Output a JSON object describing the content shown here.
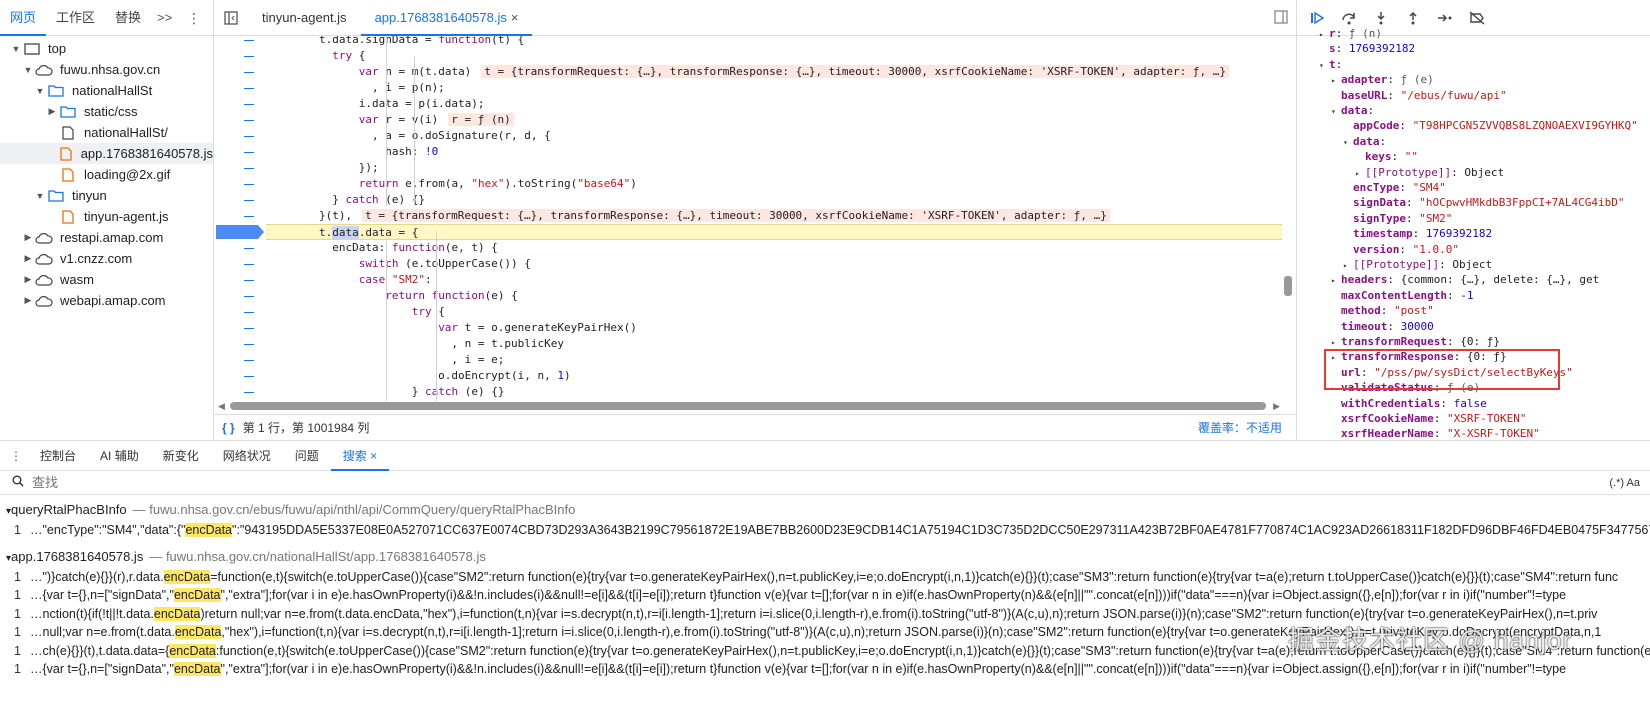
{
  "navigator": {
    "tabs": [
      "网页",
      "工作区",
      "替换"
    ],
    "more": ">>",
    "tree": [
      {
        "label": "top",
        "level": 0,
        "type": "frame",
        "expanded": true
      },
      {
        "label": "fuwu.nhsa.gov.cn",
        "level": 1,
        "type": "cloud",
        "expanded": true
      },
      {
        "label": "nationalHallSt",
        "level": 2,
        "type": "folder",
        "expanded": true
      },
      {
        "label": "static/css",
        "level": 3,
        "type": "folder",
        "expanded": false
      },
      {
        "label": "nationalHallSt/",
        "level": 3,
        "type": "file",
        "expanded": null
      },
      {
        "label": "app.1768381640578.js",
        "level": 3,
        "type": "js",
        "expanded": null,
        "selected": true
      },
      {
        "label": "loading@2x.gif",
        "level": 3,
        "type": "js",
        "expanded": null
      },
      {
        "label": "tinyun",
        "level": 2,
        "type": "folder",
        "expanded": true
      },
      {
        "label": "tinyun-agent.js",
        "level": 3,
        "type": "js",
        "expanded": null
      },
      {
        "label": "restapi.amap.com",
        "level": 1,
        "type": "cloud",
        "expanded": false
      },
      {
        "label": "v1.cnzz.com",
        "level": 1,
        "type": "cloud",
        "expanded": false
      },
      {
        "label": "wasm",
        "level": 1,
        "type": "cloud",
        "expanded": false
      },
      {
        "label": "webapi.amap.com",
        "level": 1,
        "type": "cloud",
        "expanded": false
      }
    ]
  },
  "editor": {
    "tabs": [
      {
        "label": "tinyun-agent.js",
        "active": false,
        "closable": false
      },
      {
        "label": "app.1768381640578.js",
        "active": true,
        "closable": true
      }
    ],
    "close_glyph": "×",
    "lines": [
      {
        "text": "        t.data.signData = function(t) {",
        "indent": 0,
        "inline": ""
      },
      {
        "text": "          try {",
        "inline": ""
      },
      {
        "text": "              var n = m(t.data)",
        "inline": "t = {transformRequest: {…}, transformResponse: {…}, timeout: 30000, xsrfCookieName: 'XSRF-TOKEN', adapter: ƒ, …}"
      },
      {
        "text": "                , i = p(n);",
        "inline": ""
      },
      {
        "text": "              i.data = p(i.data);",
        "inline": ""
      },
      {
        "text": "              var r = v(i)",
        "inline": "r = ƒ (n)"
      },
      {
        "text": "                , a = o.doSignature(r, d, {",
        "inline": ""
      },
      {
        "text": "                  hash: !0",
        "inline": ""
      },
      {
        "text": "              });",
        "inline": ""
      },
      {
        "text": "              return e.from(a, \"hex\").toString(\"base64\")",
        "inline": ""
      },
      {
        "text": "          } catch (e) {}",
        "inline": ""
      },
      {
        "text": "        }(t),",
        "inline": "t = {transformRequest: {…}, transformResponse: {…}, timeout: 30000, xsrfCookieName: 'XSRF-TOKEN', adapter: ƒ, …}"
      },
      {
        "text": "        t.data.data = {",
        "inline": "",
        "highlight": true
      },
      {
        "text": "          encData: function(e, t) {",
        "inline": ""
      },
      {
        "text": "              switch (e.toUpperCase()) {",
        "inline": ""
      },
      {
        "text": "              case \"SM2\":",
        "inline": ""
      },
      {
        "text": "                  return function(e) {",
        "inline": ""
      },
      {
        "text": "                      try {",
        "inline": ""
      },
      {
        "text": "                          var t = o.generateKeyPairHex()",
        "inline": ""
      },
      {
        "text": "                            , n = t.publicKey",
        "inline": ""
      },
      {
        "text": "                            , i = e;",
        "inline": ""
      },
      {
        "text": "                          o.doEncrypt(i, n, 1)",
        "inline": ""
      },
      {
        "text": "                      } catch (e) {}",
        "inline": ""
      },
      {
        "text": "                  }(t);",
        "inline": ""
      }
    ],
    "status": "第 1 行，第 1001984 列",
    "coverage": "覆盖率：不适用",
    "brace": "{ }"
  },
  "scope": {
    "rows": [
      {
        "indent": 0,
        "tri": "▸",
        "key": "r",
        "sep": ": ",
        "val": "ƒ (n)",
        "vtype": "dim"
      },
      {
        "indent": 0,
        "tri": "",
        "key": "s",
        "sep": ": ",
        "val": "1769392182",
        "vtype": "num"
      },
      {
        "indent": 0,
        "tri": "▾",
        "key": "t",
        "sep": ":",
        "val": "",
        "vtype": "dim"
      },
      {
        "indent": 1,
        "tri": "▸",
        "key": "adapter",
        "sep": ": ",
        "val": "ƒ (e)",
        "vtype": "dim"
      },
      {
        "indent": 1,
        "tri": "",
        "key": "baseURL",
        "sep": ": ",
        "val": "\"/ebus/fuwu/api\"",
        "vtype": "str"
      },
      {
        "indent": 1,
        "tri": "▾",
        "key": "data",
        "sep": ":",
        "val": "",
        "vtype": "dim"
      },
      {
        "indent": 2,
        "tri": "",
        "key": "appCode",
        "sep": ": ",
        "val": "\"T98HPCGN5ZVVQBS8LZQNOAEXVI9GYHKQ\"",
        "vtype": "str"
      },
      {
        "indent": 2,
        "tri": "▾",
        "key": "data",
        "sep": ":",
        "val": "",
        "vtype": "dim"
      },
      {
        "indent": 3,
        "tri": "",
        "key": "keys",
        "sep": ": ",
        "val": "\"\"",
        "vtype": "str"
      },
      {
        "indent": 3,
        "tri": "▸",
        "key": "[[Prototype]]",
        "sep": ": ",
        "val": "Object",
        "vtype": "plain"
      },
      {
        "indent": 2,
        "tri": "",
        "key": "encType",
        "sep": ": ",
        "val": "\"SM4\"",
        "vtype": "str"
      },
      {
        "indent": 2,
        "tri": "",
        "key": "signData",
        "sep": ": ",
        "val": "\"hOCpwvHMkdbB3FppCI+7AL4CG4ibD\"",
        "vtype": "str"
      },
      {
        "indent": 2,
        "tri": "",
        "key": "signType",
        "sep": ": ",
        "val": "\"SM2\"",
        "vtype": "str"
      },
      {
        "indent": 2,
        "tri": "",
        "key": "timestamp",
        "sep": ": ",
        "val": "1769392182",
        "vtype": "num"
      },
      {
        "indent": 2,
        "tri": "",
        "key": "version",
        "sep": ": ",
        "val": "\"1.0.0\"",
        "vtype": "str"
      },
      {
        "indent": 2,
        "tri": "▸",
        "key": "[[Prototype]]",
        "sep": ": ",
        "val": "Object",
        "vtype": "plain"
      },
      {
        "indent": 1,
        "tri": "▸",
        "key": "headers",
        "sep": ": ",
        "val": "{common: {…}, delete: {…}, get",
        "vtype": "plain"
      },
      {
        "indent": 1,
        "tri": "",
        "key": "maxContentLength",
        "sep": ": ",
        "val": "-1",
        "vtype": "num"
      },
      {
        "indent": 1,
        "tri": "",
        "key": "method",
        "sep": ": ",
        "val": "\"post\"",
        "vtype": "str"
      },
      {
        "indent": 1,
        "tri": "",
        "key": "timeout",
        "sep": ": ",
        "val": "30000",
        "vtype": "num"
      },
      {
        "indent": 1,
        "tri": "▸",
        "key": "transformRequest",
        "sep": ": ",
        "val": "{0: ƒ}",
        "vtype": "plain"
      },
      {
        "indent": 1,
        "tri": "▸",
        "key": "transformResponse",
        "sep": ": ",
        "val": "{0: ƒ}",
        "vtype": "plain"
      },
      {
        "indent": 1,
        "tri": "",
        "key": "url",
        "sep": ": ",
        "val": "\"/pss/pw/sysDict/selectByKeys\"",
        "vtype": "str"
      },
      {
        "indent": 1,
        "tri": "▸",
        "key": "validateStatus",
        "sep": ": ",
        "val": "ƒ (e)",
        "vtype": "dim"
      },
      {
        "indent": 1,
        "tri": "",
        "key": "withCredentials",
        "sep": ": ",
        "val": "false",
        "vtype": "num"
      },
      {
        "indent": 1,
        "tri": "",
        "key": "xsrfCookieName",
        "sep": ": ",
        "val": "\"XSRF-TOKEN\"",
        "vtype": "str"
      },
      {
        "indent": 1,
        "tri": "",
        "key": "xsrfHeaderName",
        "sep": ": ",
        "val": "\"X-XSRF-TOKEN\"",
        "vtype": "str"
      }
    ]
  },
  "drawer": {
    "tabs": [
      {
        "label": "控制台",
        "active": false
      },
      {
        "label": "AI 辅助",
        "active": false
      },
      {
        "label": "新变化",
        "active": false
      },
      {
        "label": "网络状况",
        "active": false
      },
      {
        "label": "问题",
        "active": false
      },
      {
        "label": "搜索",
        "active": true
      }
    ],
    "close_glyph": "×",
    "search_placeholder": "查找",
    "search_options": "(.*)  Aa"
  },
  "results": [
    {
      "file": "queryRtalPhacBInfo",
      "path": "— fuwu.nhsa.gov.cn/ebus/fuwu/api/nthl/api/CommQuery/queryRtalPhacBInfo",
      "lines": [
        {
          "n": "1",
          "pre": "…\"encType\":\"SM4\",\"data\":{\"",
          "match": "encData",
          "post": "\":\"943195DDA5E5337E08E0A527071CC637E0074CBD73D293A3643B2199C79561872E19ABE7BB2600D23E9CDB14C1A75194C1D3C735D2DCC50E297311A423B72BF0AE4781F770874C1AC923AD26618311F182DFD96DBF46FD4EB0475F347756783D"
        }
      ]
    },
    {
      "file": "app.1768381640578.js",
      "path": "— fuwu.nhsa.gov.cn/nationalHallSt/app.1768381640578.js",
      "lines": [
        {
          "n": "1",
          "pre": "…\")}catch(e){}}(r),r.data.",
          "match": "encData",
          "post": "=function(e,t){switch(e.toUpperCase()){case\"SM2\":return function(e){try{var t=o.generateKeyPairHex(),n=t.publicKey,i=e;o.doEncrypt(i,n,1)}catch(e){}}(t);case\"SM3\":return function(e){try{var t=a(e);return t.toUpperCase()}catch(e){}}(t);case\"SM4\":return func"
        },
        {
          "n": "1",
          "pre": "…{var t={},n=[\"signData\",\"",
          "match": "encData",
          "post": "\",\"extra\"];for(var i in e)e.hasOwnProperty(i)&&!n.includes(i)&&null!=e[i]&&(t[i]=e[i]);return t}function v(e){var t=[];for(var n in e)if(e.hasOwnProperty(n)&&(e[n]||\"\".concat(e[n])))if(\"data\"===n){var i=Object.assign({},e[n]);for(var r in i)if(\"number\"!=type"
        },
        {
          "n": "1",
          "pre": "…nction(t){if(!t||!t.data.",
          "match": "encData",
          "post": ")return null;var n=e.from(t.data.encData,\"hex\"),i=function(t,n){var i=s.decrypt(n,t),r=i[i.length-1];return i=i.slice(0,i.length-r),e.from(i).toString(\"utf-8\")}(A(c,u),n);return JSON.parse(i)}(n);case\"SM2\":return function(e){try{var t=o.generateKeyPairHex(),n=t.priv"
        },
        {
          "n": "1",
          "pre": "…null;var n=e.from(t.data.",
          "match": "encData",
          "post": ",\"hex\"),i=function(t,n){var i=s.decrypt(n,t),r=i[i.length-1];return i=i.slice(0,i.length-r),e.from(i).toString(\"utf-8\")}(A(c,u),n);return JSON.parse(i)}(n);case\"SM2\":return function(e){try{var t=o.generateKeyPairHex(),n=t.privateKey;o.doDecrypt(encryptData,n,1"
        },
        {
          "n": "1",
          "pre": "…ch(e){}}(t),t.data.data={",
          "match": "encData",
          "post": ":function(e,t){switch(e.toUpperCase()){case\"SM2\":return function(e){try{var t=o.generateKeyPairHex(),n=t.publicKey,i=e;o.doEncrypt(i,n,1)}catch(e){}}(t);case\"SM3\":return function(e){try{var t=a(e);return t.toUpperCase()}catch(e){}}(t);case\"SM4\":return function(e"
        },
        {
          "n": "1",
          "pre": "…{var t={},n=[\"signData\",\"",
          "match": "encData",
          "post": "\",\"extra\"];for(var i in e)e.hasOwnProperty(i)&&!n.includes(i)&&null!=e[i]&&(t[i]=e[i]);return t}function v(e){var t=[];for(var n in e)if(e.hasOwnProperty(n)&&(e[n]||\"\".concat(e[n])))if(\"data\"===n){var i=Object.assign({},e[n]);for(var r in i)if(\"number\"!=type"
        }
      ]
    }
  ],
  "watermark": "掘金技术社区 @ hanjor",
  "colors": {
    "accent": "#1a73e8",
    "highlight_line": "#fff8c5",
    "match": "#ffe664",
    "annotation_box": "#e53935"
  }
}
